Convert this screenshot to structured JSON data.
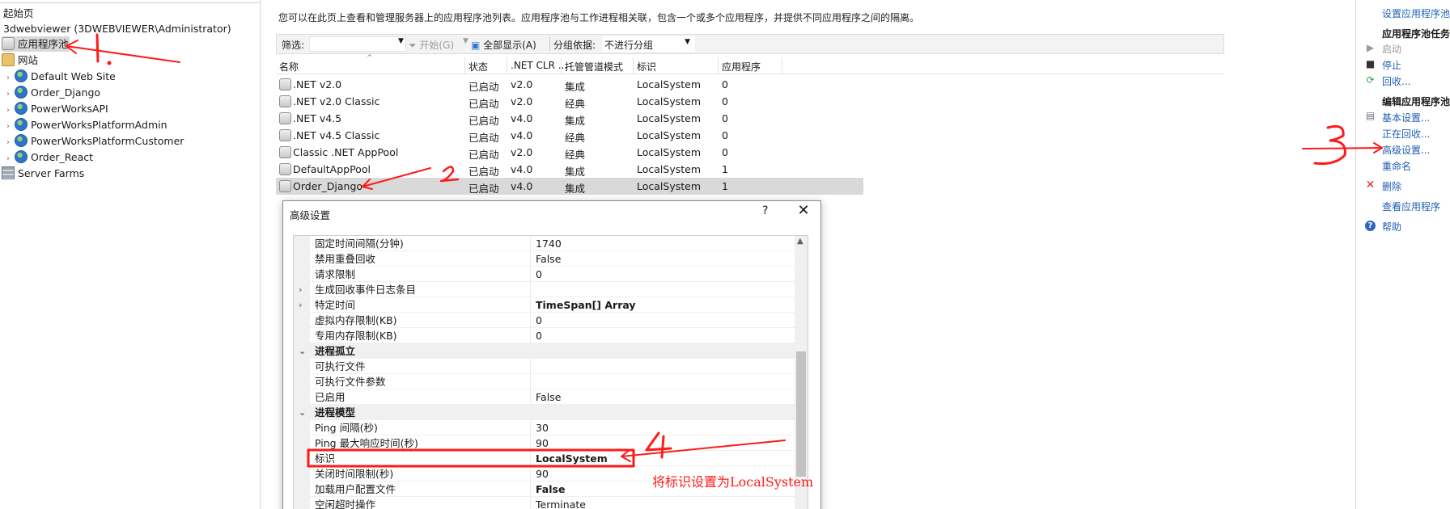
{
  "tree": {
    "start_page": "起始页",
    "server": "3dwebviewer (3DWEBVIEWER\\Administrator)",
    "app_pools": "应用程序池",
    "sites": "网站",
    "site_items": [
      "Default Web Site",
      "Order_Django",
      "PowerWorksAPI",
      "PowerWorksPlatformAdmin",
      "PowerWorksPlatformCustomer",
      "Order_React"
    ],
    "server_farms": "Server Farms"
  },
  "center": {
    "description": "您可以在此页上查看和管理服务器上的应用程序池列表。应用程序池与工作进程相关联，包含一个或多个应用程序，并提供不同应用程序之间的隔离。",
    "toolbar": {
      "filter_label": "筛选:",
      "start_label": "开始(G)",
      "show_all_label": "全部显示(A)",
      "group_by_label": "分组依据:",
      "group_by_value": "不进行分组"
    },
    "columns": [
      "名称",
      "状态",
      ".NET CLR ...",
      "托管管道模式",
      "标识",
      "应用程序"
    ],
    "rows": [
      {
        "name": ".NET v2.0",
        "status": "已启动",
        "clr": "v2.0",
        "mode": "集成",
        "identity": "LocalSystem",
        "apps": "0"
      },
      {
        "name": ".NET v2.0 Classic",
        "status": "已启动",
        "clr": "v2.0",
        "mode": "经典",
        "identity": "LocalSystem",
        "apps": "0"
      },
      {
        "name": ".NET v4.5",
        "status": "已启动",
        "clr": "v4.0",
        "mode": "集成",
        "identity": "LocalSystem",
        "apps": "0"
      },
      {
        "name": ".NET v4.5 Classic",
        "status": "已启动",
        "clr": "v4.0",
        "mode": "经典",
        "identity": "LocalSystem",
        "apps": "0"
      },
      {
        "name": "Classic .NET AppPool",
        "status": "已启动",
        "clr": "v2.0",
        "mode": "经典",
        "identity": "LocalSystem",
        "apps": "0"
      },
      {
        "name": "DefaultAppPool",
        "status": "已启动",
        "clr": "v4.0",
        "mode": "集成",
        "identity": "LocalSystem",
        "apps": "1"
      },
      {
        "name": "Order_Django",
        "status": "已启动",
        "clr": "v4.0",
        "mode": "集成",
        "identity": "LocalSystem",
        "apps": "1"
      }
    ]
  },
  "dialog": {
    "title": "高级设置",
    "help": "?",
    "close": "✕",
    "rows": [
      {
        "name": "固定时间间隔(分钟)",
        "value": "1740"
      },
      {
        "name": "禁用重叠回收",
        "value": "False"
      },
      {
        "name": "请求限制",
        "value": "0"
      },
      {
        "name": "生成回收事件日志条目",
        "value": ""
      },
      {
        "name": "特定时间",
        "value": "TimeSpan[] Array"
      },
      {
        "name": "虚拟内存限制(KB)",
        "value": "0"
      },
      {
        "name": "专用内存限制(KB)",
        "value": "0"
      },
      {
        "name": "进程孤立",
        "value": ""
      },
      {
        "name": "可执行文件",
        "value": ""
      },
      {
        "name": "可执行文件参数",
        "value": ""
      },
      {
        "name": "已启用",
        "value": "False"
      },
      {
        "name": "进程模型",
        "value": ""
      },
      {
        "name": "Ping 间隔(秒)",
        "value": "30"
      },
      {
        "name": "Ping 最大响应时间(秒)",
        "value": "90"
      },
      {
        "name": "标识",
        "value": "LocalSystem"
      },
      {
        "name": "关闭时间限制(秒)",
        "value": "90"
      },
      {
        "name": "加载用户配置文件",
        "value": "False"
      },
      {
        "name": "空闲超时操作",
        "value": "Terminate"
      }
    ]
  },
  "actions": {
    "set_defaults": "设置应用程序池",
    "tasks_header": "应用程序池任务",
    "start": "启动",
    "stop": "停止",
    "recycle": "回收...",
    "edit_header": "编辑应用程序池",
    "basic_settings": "基本设置...",
    "recycling": "正在回收...",
    "advanced_settings": "高级设置...",
    "rename": "重命名",
    "delete": "删除",
    "view_apps": "查看应用程序",
    "help": "帮助"
  },
  "annotations": {
    "note": "将标识设置为LocalSystem",
    "color": "#ff1a1a"
  }
}
